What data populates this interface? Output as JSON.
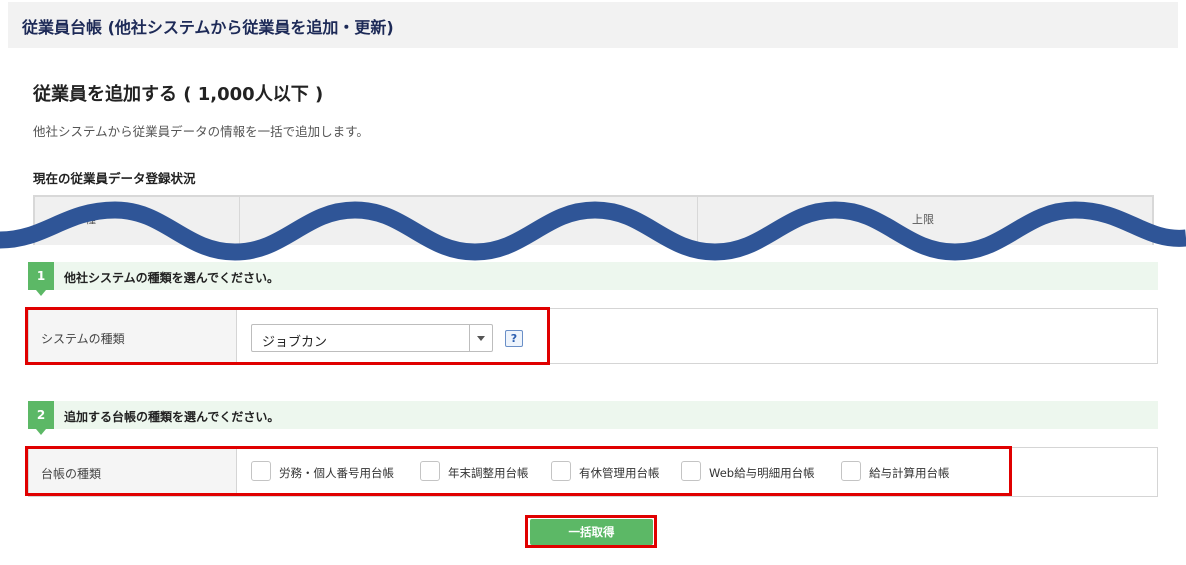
{
  "header": {
    "title": "従業員台帳 (他社システムから従業員を追加・更新)"
  },
  "main": {
    "title": "従業員を追加する ( 1,000人以下 )",
    "description": "他社システムから従業員データの情報を一括で追加します。"
  },
  "status": {
    "title": "現在の従業員データ登録状況",
    "column1_partial": "種",
    "column3": "上限"
  },
  "step1": {
    "number": "1",
    "label": "他社システムの種類を選んでください。",
    "field_label": "システムの種類",
    "select_value": "ジョブカン",
    "help_label": "?"
  },
  "step2": {
    "number": "2",
    "label": "追加する台帳の種類を選んでください。",
    "field_label": "台帳の種類",
    "checkboxes": [
      {
        "label": "労務・個人番号用台帳",
        "checked": false
      },
      {
        "label": "年末調整用台帳",
        "checked": false
      },
      {
        "label": "有休管理用台帳",
        "checked": false
      },
      {
        "label": "Web給与明細用台帳",
        "checked": false
      },
      {
        "label": "給与計算用台帳",
        "checked": false
      }
    ]
  },
  "actions": {
    "submit_label": "一括取得"
  },
  "colors": {
    "accent_green": "#5cb866",
    "highlight_red": "#e00000",
    "wave_blue": "#2f5597",
    "header_text": "#1d2a57"
  }
}
